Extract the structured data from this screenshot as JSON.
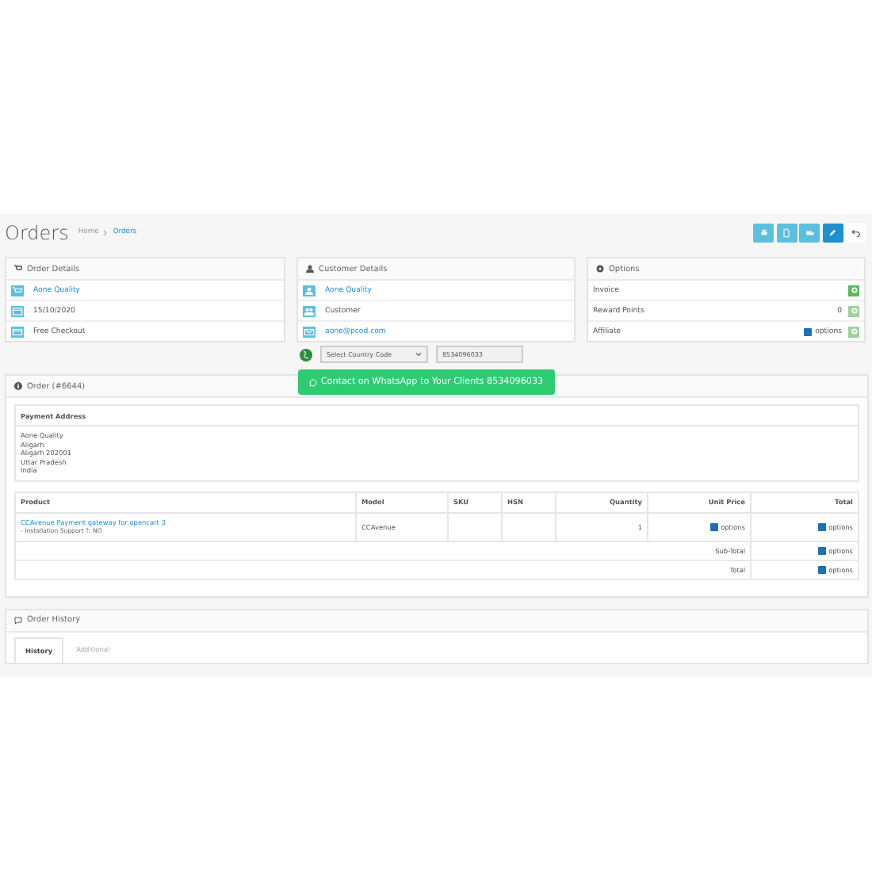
{
  "page": {
    "title": "Orders",
    "breadcrumb": [
      "Home",
      "Orders"
    ]
  },
  "order_details": {
    "title": "Order Details",
    "rows": [
      {
        "kind": "store",
        "text": "Aone Quality",
        "link": true
      },
      {
        "kind": "date",
        "text": "15/10/2020",
        "link": false
      },
      {
        "kind": "payment",
        "text": "Free Checkout",
        "link": false
      }
    ]
  },
  "customer_details": {
    "title": "Customer Details",
    "rows": [
      {
        "kind": "user",
        "text": "Aone Quality",
        "link": true
      },
      {
        "kind": "group",
        "text": "Customer",
        "link": false
      },
      {
        "kind": "email",
        "text": "aone@pcod.com",
        "link": true
      }
    ],
    "country_select": {
      "value": "Select Country Code"
    },
    "phone": {
      "value": "8534096033"
    },
    "whatsapp_button": "Contact on WhatsApp to Your Clients 8534096033"
  },
  "options": {
    "title": "Options",
    "rows": [
      {
        "label": "Invoice",
        "disabled": false
      },
      {
        "label": "Reward Points",
        "value": "0",
        "disabled": true
      },
      {
        "label": "Affiliate",
        "checkbox_label": "options",
        "checked": true,
        "disabled": true
      }
    ]
  },
  "order": {
    "title": "Order (#6644)",
    "payment_address": {
      "title": "Payment Address",
      "lines": [
        "Aone Quality",
        "Aligarh",
        "Aligarh 202001",
        "Uttar Pradesh",
        "India"
      ]
    },
    "table": {
      "columns": [
        "Product",
        "Model",
        "SKU",
        "HSN",
        "Quantity",
        "Unit Price",
        "Total"
      ],
      "rows": [
        {
          "product": "CCAvenue Payment gateway for opencart 3",
          "option": "- Installation Support ?: NO",
          "model": "CCAvenue",
          "quantity": "1",
          "unit_price": {
            "label": "options",
            "checked": true
          },
          "total": {
            "label": "options",
            "checked": true
          }
        }
      ],
      "totals": [
        {
          "label": "Sub-Total",
          "value": {
            "label": "options",
            "checked": true
          }
        },
        {
          "label": "Total",
          "value": {
            "label": "options",
            "checked": true
          }
        }
      ]
    }
  },
  "history": {
    "title": "Order History",
    "tabs": [
      {
        "label": "History",
        "selected": true
      },
      {
        "label": "Additional",
        "selected": false
      }
    ]
  }
}
